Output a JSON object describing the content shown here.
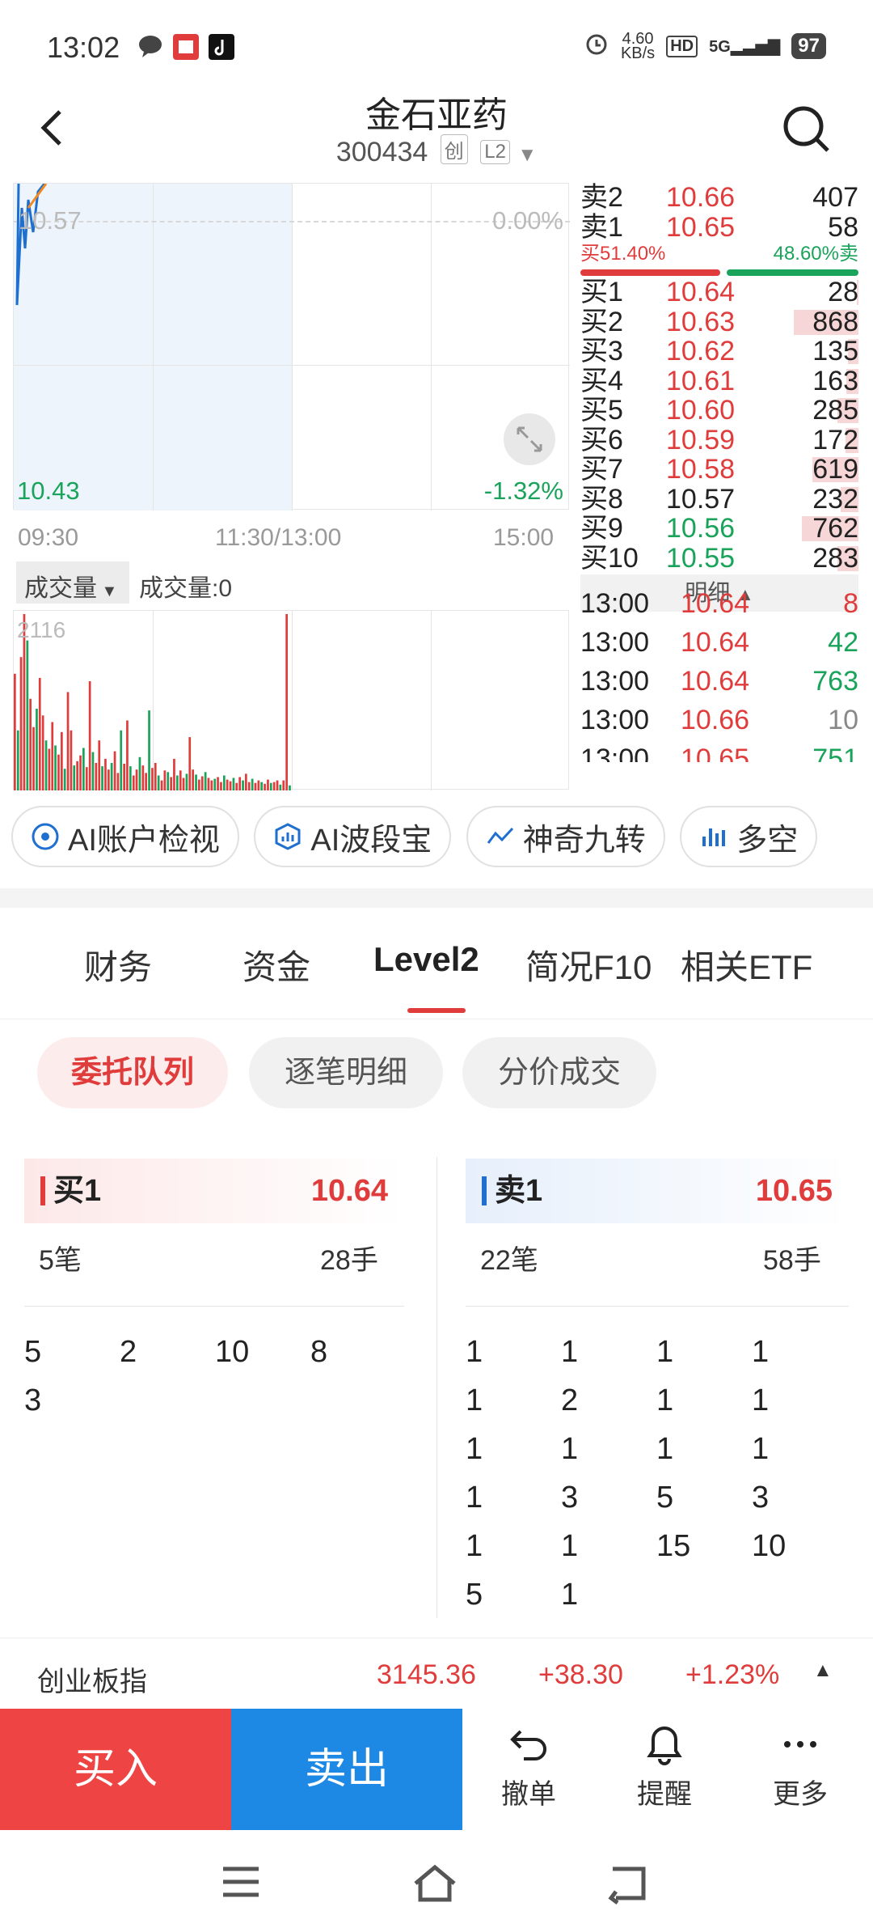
{
  "status": {
    "time": "13:02",
    "net_speed": "4.60",
    "net_unit": "KB/s",
    "hd": "HD",
    "sig": "5G",
    "battery": "97"
  },
  "header": {
    "title": "金石亚药",
    "code": "300434",
    "tag1": "创",
    "tag2": "L2"
  },
  "chart": {
    "price_ref": "10.57",
    "pct_ref": "0.00%",
    "price_low": "10.43",
    "pct_low": "-1.32%",
    "times": [
      "09:30",
      "11:30/13:00",
      "15:00"
    ],
    "vol_selector": "成交量",
    "vol_label": "成交量:0",
    "vol_max": "2116"
  },
  "chart_data": {
    "type": "bar",
    "title": "成交量",
    "series": [
      {
        "name": "成交量",
        "values": [
          1400,
          720,
          1600,
          2116,
          1800,
          1100,
          760,
          980,
          1350,
          900,
          600,
          500,
          820,
          540,
          430,
          700,
          260,
          1180,
          720,
          300,
          350,
          420,
          510,
          280,
          1310,
          460,
          330,
          600,
          290,
          380,
          250,
          330,
          470,
          210,
          720,
          320,
          840,
          290,
          180,
          250,
          400,
          300,
          210,
          960,
          270,
          330,
          180,
          120,
          240,
          220,
          160,
          380,
          180,
          240,
          150,
          200,
          640,
          250,
          190,
          130,
          170,
          220,
          150,
          120,
          140,
          160,
          100,
          180,
          130,
          110,
          150,
          90,
          160,
          120,
          200,
          100,
          140,
          90,
          120,
          100,
          80,
          130,
          90,
          100,
          120,
          70,
          120,
          2116,
          60
        ]
      }
    ],
    "ylim": [
      0,
      2116
    ]
  },
  "orderbook": {
    "asks": [
      {
        "label": "卖2",
        "price": "10.66",
        "vol": "407",
        "color": "red"
      },
      {
        "label": "卖1",
        "price": "10.65",
        "vol": "58",
        "color": "red"
      }
    ],
    "buy_pct": "买51.40%",
    "sell_pct": "48.60%卖",
    "buy_ratio": 0.514,
    "bids": [
      {
        "label": "买1",
        "price": "10.64",
        "vol": "28",
        "color": "red",
        "bar": 0.03
      },
      {
        "label": "买2",
        "price": "10.63",
        "vol": "868",
        "color": "red",
        "bar": 1.0
      },
      {
        "label": "买3",
        "price": "10.62",
        "vol": "135",
        "color": "red",
        "bar": 0.16
      },
      {
        "label": "买4",
        "price": "10.61",
        "vol": "163",
        "color": "red",
        "bar": 0.19
      },
      {
        "label": "买5",
        "price": "10.60",
        "vol": "285",
        "color": "red",
        "bar": 0.33
      },
      {
        "label": "买6",
        "price": "10.59",
        "vol": "172",
        "color": "red",
        "bar": 0.2
      },
      {
        "label": "买7",
        "price": "10.58",
        "vol": "619",
        "color": "red",
        "bar": 0.71
      },
      {
        "label": "买8",
        "price": "10.57",
        "vol": "232",
        "color": "black",
        "bar": 0.27
      },
      {
        "label": "买9",
        "price": "10.56",
        "vol": "762",
        "color": "green",
        "bar": 0.88
      },
      {
        "label": "买10",
        "price": "10.55",
        "vol": "283",
        "color": "green",
        "bar": 0.33
      }
    ],
    "detail_label": "明细"
  },
  "trades": [
    {
      "time": "13:00",
      "price": "10.64",
      "vol": "8",
      "pcolor": "red",
      "vcolor": "red"
    },
    {
      "time": "13:00",
      "price": "10.64",
      "vol": "42",
      "pcolor": "red",
      "vcolor": "green"
    },
    {
      "time": "13:00",
      "price": "10.64",
      "vol": "763",
      "pcolor": "red",
      "vcolor": "green"
    },
    {
      "time": "13:00",
      "price": "10.66",
      "vol": "10",
      "pcolor": "red",
      "vcolor": "gray"
    },
    {
      "time": "13:00",
      "price": "10.65",
      "vol": "751",
      "pcolor": "red",
      "vcolor": "green"
    }
  ],
  "chips": [
    "AI账户检视",
    "AI波段宝",
    "神奇九转",
    "多空"
  ],
  "tabs": [
    "财务",
    "资金",
    "Level2",
    "简况F10",
    "相关ETF"
  ],
  "subtabs": [
    "委托队列",
    "逐笔明细",
    "分价成交"
  ],
  "queue": {
    "buy": {
      "label": "买1",
      "price": "10.64",
      "count": "5笔",
      "hands": "28手",
      "orders": [
        "5",
        "2",
        "10",
        "8",
        "3"
      ]
    },
    "sell": {
      "label": "卖1",
      "price": "10.65",
      "count": "22笔",
      "hands": "58手",
      "orders": [
        "1",
        "1",
        "1",
        "1",
        "1",
        "2",
        "1",
        "1",
        "1",
        "1",
        "1",
        "1",
        "1",
        "3",
        "5",
        "3",
        "1",
        "1",
        "15",
        "10",
        "5",
        "1"
      ]
    }
  },
  "index": {
    "name": "创业板指",
    "value": "3145.36",
    "change": "+38.30",
    "pct": "+1.23%"
  },
  "bottom": {
    "buy": "买入",
    "sell": "卖出",
    "cancel": "撤单",
    "remind": "提醒",
    "more": "更多"
  }
}
